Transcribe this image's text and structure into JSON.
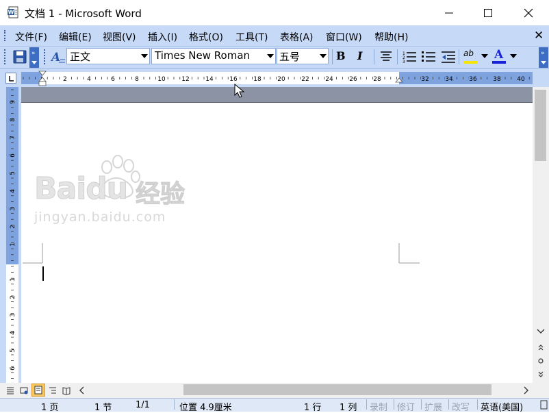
{
  "window": {
    "title": "文档 1 - Microsoft Word",
    "minimize_glyph": "─",
    "maximize_glyph": "☐",
    "close_glyph": "✕"
  },
  "menu": {
    "items": [
      "文件(F)",
      "编辑(E)",
      "视图(V)",
      "插入(I)",
      "格式(O)",
      "工具(T)",
      "表格(A)",
      "窗口(W)",
      "帮助(H)"
    ],
    "close_glyph": "✕"
  },
  "toolbar": {
    "style_value": "正文",
    "font_value": "Times New Roman",
    "size_value": "五号",
    "bold_label": "B",
    "italic_label": "I",
    "font_color_label": "A",
    "highlight_label": "ab",
    "style_icon_label": "A",
    "highlight_color": "#f5e600",
    "font_color": "#1a22d8"
  },
  "rulers": {
    "horizontal_labels": [
      "2",
      "4",
      "6",
      "8",
      "10",
      "12",
      "14",
      "16",
      "18",
      "20",
      "22",
      "24",
      "26",
      "28",
      "32",
      "34",
      "36",
      "38",
      "40"
    ],
    "vertical_labels_top": [
      "9",
      "8",
      "7",
      "6",
      "5",
      "4",
      "3",
      "2",
      "1"
    ],
    "vertical_labels_bottom": [
      "1",
      "2",
      "3",
      "4",
      "5",
      "6"
    ]
  },
  "watermark": {
    "brand": "Baidu",
    "brand_suffix": "经验",
    "url": "jingyan.baidu.com"
  },
  "statusbar": {
    "page": "1 页",
    "section": "1 节",
    "page_of": "1/1",
    "position": "位置 4.9厘米",
    "line": "1 行",
    "column": "1 列",
    "rec": "录制",
    "trk": "修订",
    "ext": "扩展",
    "ovr": "改写",
    "language": "英语(美国)"
  },
  "colors": {
    "menubar": "#c6d9f7",
    "ruler_margin": "#7ea3df",
    "doc_gap": "#8b93a4"
  }
}
